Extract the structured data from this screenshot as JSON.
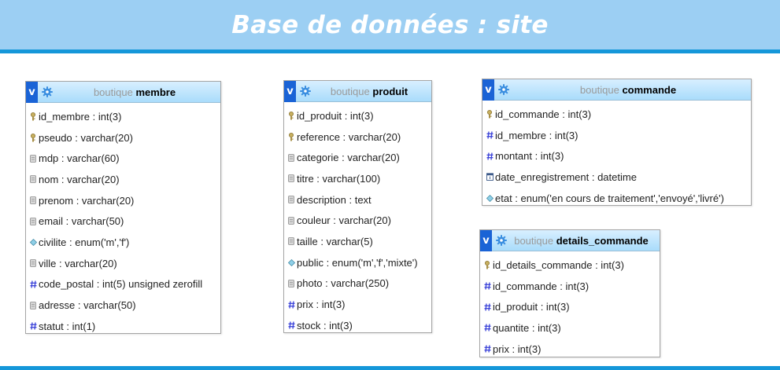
{
  "header": {
    "title": "Base de données : site"
  },
  "tables": {
    "membre": {
      "db": "boutique",
      "name": "membre",
      "columns": [
        {
          "label": "id_membre : int(3)",
          "icon": "key-icon"
        },
        {
          "label": "pseudo : varchar(20)",
          "icon": "key-icon"
        },
        {
          "label": "mdp : varchar(60)",
          "icon": "text-column-icon"
        },
        {
          "label": "nom : varchar(20)",
          "icon": "text-column-icon"
        },
        {
          "label": "prenom : varchar(20)",
          "icon": "text-column-icon"
        },
        {
          "label": "email : varchar(50)",
          "icon": "text-column-icon"
        },
        {
          "label": "civilite : enum('m','f')",
          "icon": "enum-column-icon"
        },
        {
          "label": "ville : varchar(20)",
          "icon": "text-column-icon"
        },
        {
          "label": "code_postal : int(5) unsigned zerofill",
          "icon": "numeric-column-icon"
        },
        {
          "label": "adresse : varchar(50)",
          "icon": "text-column-icon"
        },
        {
          "label": "statut : int(1)",
          "icon": "numeric-column-icon"
        }
      ]
    },
    "produit": {
      "db": "boutique",
      "name": "produit",
      "columns": [
        {
          "label": "id_produit : int(3)",
          "icon": "key-icon"
        },
        {
          "label": "reference : varchar(20)",
          "icon": "key-icon"
        },
        {
          "label": "categorie : varchar(20)",
          "icon": "text-column-icon"
        },
        {
          "label": "titre : varchar(100)",
          "icon": "text-column-icon"
        },
        {
          "label": "description : text",
          "icon": "text-column-icon"
        },
        {
          "label": "couleur : varchar(20)",
          "icon": "text-column-icon"
        },
        {
          "label": "taille : varchar(5)",
          "icon": "text-column-icon"
        },
        {
          "label": "public : enum('m','f','mixte')",
          "icon": "enum-column-icon"
        },
        {
          "label": "photo : varchar(250)",
          "icon": "text-column-icon"
        },
        {
          "label": "prix : int(3)",
          "icon": "numeric-column-icon"
        },
        {
          "label": "stock : int(3)",
          "icon": "numeric-column-icon"
        }
      ]
    },
    "commande": {
      "db": "boutique",
      "name": "commande",
      "columns": [
        {
          "label": "id_commande : int(3)",
          "icon": "key-icon"
        },
        {
          "label": "id_membre : int(3)",
          "icon": "numeric-column-icon"
        },
        {
          "label": "montant : int(3)",
          "icon": "numeric-column-icon"
        },
        {
          "label": "date_enregistrement : datetime",
          "icon": "datetime-column-icon"
        },
        {
          "label": "etat : enum('en cours de traitement','envoyé','livré')",
          "icon": "enum-column-icon"
        }
      ]
    },
    "details_commande": {
      "db": "boutique",
      "name": "details_commande",
      "columns": [
        {
          "label": "id_details_commande : int(3)",
          "icon": "key-icon"
        },
        {
          "label": "id_commande : int(3)",
          "icon": "numeric-column-icon"
        },
        {
          "label": "id_produit : int(3)",
          "icon": "numeric-column-icon"
        },
        {
          "label": "quantite : int(3)",
          "icon": "numeric-column-icon"
        },
        {
          "label": "prix : int(3)",
          "icon": "numeric-column-icon"
        }
      ]
    }
  },
  "colors": {
    "banner": "#9ccff3",
    "accent": "#1597d9",
    "table_header": "#a9dcfb",
    "toggle_blue": "#1a63d6"
  }
}
